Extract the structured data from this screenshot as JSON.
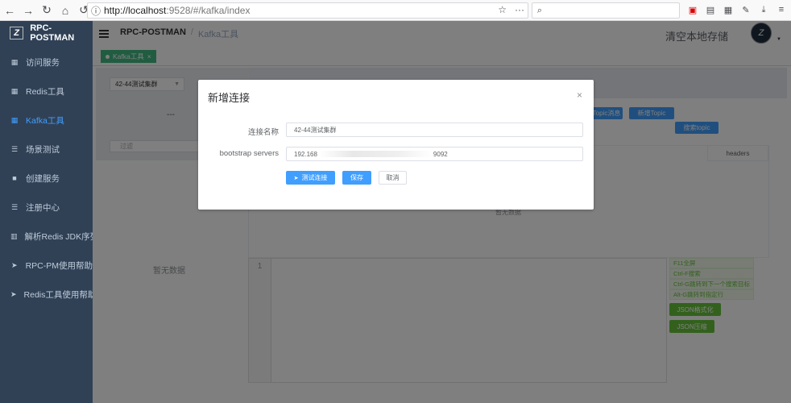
{
  "browser": {
    "url_host": "http://localhost",
    "url_path": ":9528/#/kafka/index"
  },
  "sidebar": {
    "logo_text": "RPC-POSTMAN",
    "items": [
      {
        "label": "访问服务",
        "icon": "grid-icon",
        "active": false
      },
      {
        "label": "Redis工具",
        "icon": "grid-icon",
        "active": false
      },
      {
        "label": "Kafka工具",
        "icon": "grid-icon",
        "active": true
      },
      {
        "label": "场景测试",
        "icon": "list-icon",
        "active": false
      },
      {
        "label": "创建服务",
        "icon": "folder-icon",
        "active": false
      },
      {
        "label": "注册中心",
        "icon": "list-icon",
        "active": false
      },
      {
        "label": "解析Redis JDK序列化",
        "icon": "book-icon",
        "active": false
      },
      {
        "label": "RPC-PM使用帮助",
        "icon": "send-icon",
        "active": false
      },
      {
        "label": "Redis工具使用帮助",
        "icon": "send-icon",
        "active": false
      }
    ]
  },
  "header": {
    "breadcrumb_root": "RPC-POSTMAN",
    "breadcrumb_sep": "/",
    "breadcrumb_current": "Kafka工具",
    "clear_cache": "清空本地存储"
  },
  "tags": {
    "active_tag": "Kafka工具",
    "close": "×"
  },
  "background": {
    "cluster_select": "42-44测试集群",
    "dash": "---",
    "filter_placeholder": "过滤",
    "topic_msg_button": "Topic消息",
    "add_topic_button": "新增Topic",
    "search_topic_button": "搜索topic",
    "headers_col": "headers",
    "no_data": "暂无数据",
    "no_data_left": "暂无数据",
    "editor_line": "1",
    "shortcuts": [
      "F11全屏",
      "Ctrl-F搜索",
      "Ctrl-G跳转到下一个搜索目标",
      "Alt-G跳转到指定行"
    ],
    "json_format_button": "JSON格式化",
    "json_compress_button": "JSON压缩"
  },
  "dialog": {
    "title": "新增连接",
    "close": "×",
    "name_label": "连接名称",
    "name_value": "42-44测试集群",
    "servers_label": "bootstrap servers",
    "servers_value_start": "192.168",
    "servers_value_end": "9092",
    "test_button": "测试连接",
    "save_button": "保存",
    "cancel_button": "取消"
  }
}
